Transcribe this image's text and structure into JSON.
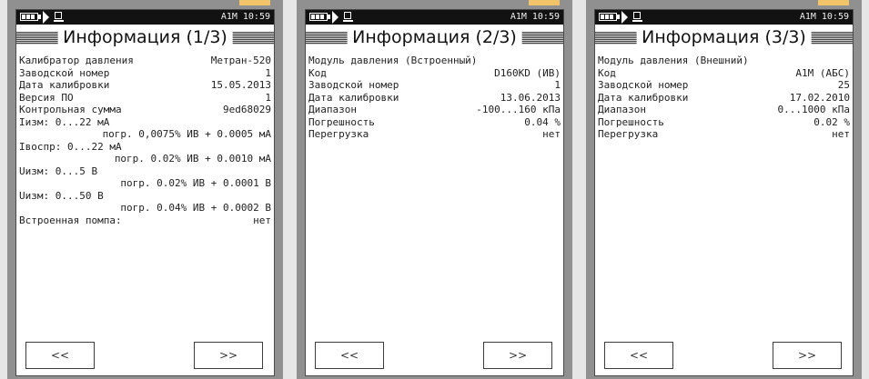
{
  "status": {
    "time": "A1M 10:59"
  },
  "panels": [
    {
      "title": "Информация  (1/3)",
      "rows": [
        {
          "label": "Калибратор давления",
          "value": "Метран-520"
        },
        {
          "label": "Заводской номер",
          "value": "1"
        },
        {
          "label": "Дата калибровки",
          "value": "15.05.2013"
        },
        {
          "label": "Версия ПО",
          "value": "1"
        },
        {
          "label": "Контрольная сумма",
          "value": "9ed68029"
        }
      ],
      "extra": [
        {
          "type": "line",
          "text": "Iизм: 0...22 мА"
        },
        {
          "type": "indent",
          "text": "погр. 0,0075% ИВ + 0.0005 мА"
        },
        {
          "type": "line",
          "text": "Iвоспр: 0...22 мА"
        },
        {
          "type": "indent",
          "text": "погр. 0.02% ИВ + 0.0010 мА"
        },
        {
          "type": "line",
          "text": "Uизм: 0...5 В"
        },
        {
          "type": "indent",
          "text": "погр. 0.02% ИВ + 0.0001 В"
        },
        {
          "type": "line",
          "text": "Uизм: 0...50 В"
        },
        {
          "type": "indent",
          "text": "погр. 0.04% ИВ + 0.0002 В"
        },
        {
          "type": "row",
          "label": "Встроенная помпа:",
          "value": "нет"
        }
      ],
      "prev_label": "<<",
      "next_label": ">>"
    },
    {
      "title": "Информация  (2/3)",
      "header": "Модуль давления (Встроенный)",
      "rows": [
        {
          "label": "Код",
          "value": "D160KD (ИВ)"
        },
        {
          "label": "Заводской номер",
          "value": "1"
        },
        {
          "label": "Дата калибровки",
          "value": "13.06.2013"
        },
        {
          "label": "Диапазон",
          "value": "-100...160 кПа"
        },
        {
          "label": "Погрешность",
          "value": "0.04 %"
        },
        {
          "label": "Перегрузка",
          "value": "нет"
        }
      ],
      "prev_label": "<<",
      "next_label": ">>"
    },
    {
      "title": "Информация  (3/3)",
      "header": "Модуль давления (Внешний)",
      "rows": [
        {
          "label": "Код",
          "value": "A1M (АБС)"
        },
        {
          "label": "Заводской номер",
          "value": "25"
        },
        {
          "label": "Дата калибровки",
          "value": "17.02.2010"
        },
        {
          "label": "Диапазон",
          "value": "0...1000 кПа"
        },
        {
          "label": "Погрешность",
          "value": "0.02 %"
        },
        {
          "label": "Перегрузка",
          "value": "нет"
        }
      ],
      "prev_label": "<<",
      "next_label": ">>"
    }
  ]
}
